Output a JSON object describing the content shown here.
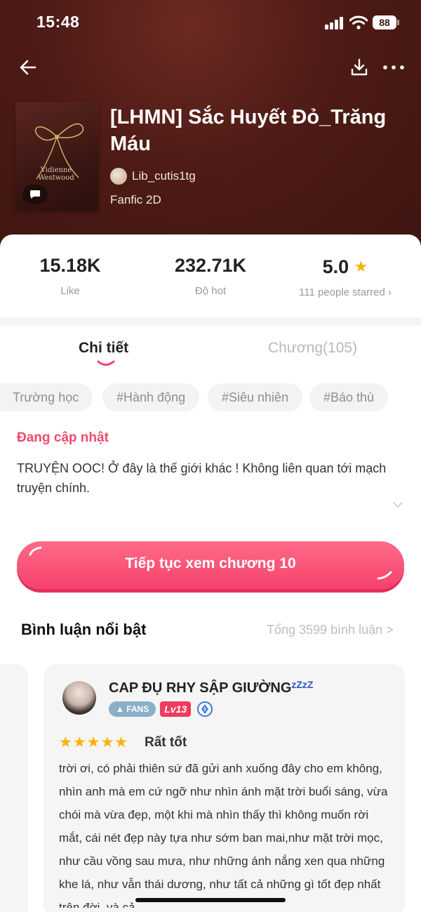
{
  "status_bar": {
    "time": "15:48",
    "battery": "88"
  },
  "book": {
    "cover_text": "Vidienne\nWestwood",
    "title": "[LHMN] Sắc Huyết Đỏ_Trăng Máu",
    "author": "Lib_cutis1tg",
    "genre": "Fanfic 2D"
  },
  "stats": [
    {
      "value": "15.18K",
      "label": "Like"
    },
    {
      "value": "232.71K",
      "label": "Độ hot"
    },
    {
      "value": "5.0",
      "label": "111 people starred ›"
    }
  ],
  "tabs": [
    {
      "label": "Chi tiết",
      "active": true
    },
    {
      "label": "Chương(105)",
      "active": false
    }
  ],
  "tags": [
    "Trường học",
    "#Hành động",
    "#Siêu nhiên",
    "#Báo thù"
  ],
  "status": "Đang cập nhật",
  "description": "TRUYỆN OOC! Ở đây là thế giới khác ! Không liên quan tới mạch truyện chính.",
  "cta_label": "Tiếp tục xem chương 10",
  "comments": {
    "title": "Bình luận nổi bật",
    "total": "Tổng 3599 bình luận >",
    "featured": {
      "user": "CAP ĐỤ RHY SẬP GIƯỜNG",
      "zzz": "zZzZ",
      "fans_badge": "FANS",
      "level": "Lv13",
      "stars": "★★★★★",
      "rating_text": "Rất tốt",
      "text": "trời ơi, có phải thiên sứ đã gửi anh xuống đây cho em không, nhìn anh mà em cứ ngỡ như nhìn ánh mặt trời buổi sáng, vừa chói mà vừa đẹp, một khi mà nhìn thấy thì không muốn rời mắt, cái nét đẹp này tựa như sớm ban mai,như mặt trời mọc, như cầu vồng sau mưa, như những ánh nắng xen qua những khe lá, như vẫn thái dương, như tất cả những gì tốt đẹp nhất trên đời, và cả"
    }
  },
  "colors": {
    "hero_bg": "#4e1b16",
    "accent_pink": "#f6416c",
    "status_pink": "#ef4b6b",
    "star_yellow": "#f7b400"
  }
}
